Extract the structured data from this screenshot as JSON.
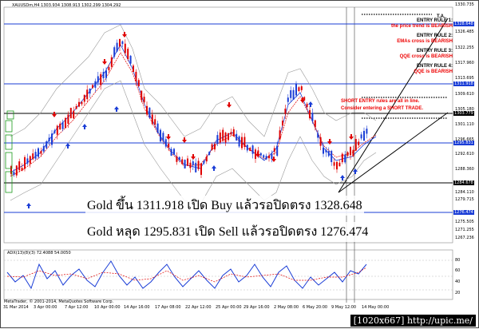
{
  "window": {
    "title": "XAUUSDm,H4  1303.934 1308.913 1302.299 1304.292"
  },
  "annotations": {
    "ta": "T.A.",
    "rules": [
      {
        "head": "ENTRY RULE 1:",
        "text": "the price trend is BEARISH"
      },
      {
        "head": "ENTRY RULE 2:",
        "text": "EMAs cross is BEARISH"
      },
      {
        "head": "ENTRY RULE 3:",
        "text": "QQE cross is BEARISH"
      },
      {
        "head": "ENTRY RULE 4:",
        "text": "QQE is BEARISH"
      }
    ],
    "short_line1": "SHORT ENTRY rules are all in line.",
    "short_line2": "Consider entering a SHORT TRADE.",
    "caption1": "Gold ขึ้น 1311.918 เปิด Buy แล้วรอปิดตรง 1328.648",
    "caption2": "Gold หลุด 1295.831 เปิด Sell แล้วรอปิดตรง 1276.474"
  },
  "price_axis": {
    "ticks": [
      "1330.735",
      "1326.485",
      "1322.255",
      "1317.960",
      "1313.695",
      "1309.610",
      "1305.180",
      "1301.110",
      "1296.665",
      "1292.610",
      "1288.360",
      "1284.110",
      "1279.715",
      "1275.505",
      "1271.255",
      "1267.236"
    ],
    "labels": [
      {
        "value": "1328.648",
        "color": "#1a3dd6"
      },
      {
        "value": "1311.918",
        "color": "#1a3dd6"
      },
      {
        "value": "1303.779",
        "color": "#000000"
      },
      {
        "value": "1295.831",
        "color": "#1a3dd6"
      },
      {
        "value": "1284.678",
        "color": "#000000"
      },
      {
        "value": "1276.474",
        "color": "#1a3dd6"
      }
    ]
  },
  "time_axis": {
    "ticks": [
      "31 Mar 2014",
      "3 Apr 00:00",
      "7 Apr 12:00",
      "10 Apr 00:00",
      "14 Apr 16:00",
      "17 Apr 08:00",
      "22 Apr 12:00",
      "25 Apr 00:00",
      "29 Apr 16:00",
      "2 May 08:00",
      "6 May 20:00",
      "9 May 12:00",
      "14 May 00:00"
    ]
  },
  "indicator": {
    "label": "ADX(13)(8)(3) 72.4088 54.0050",
    "ticks": [
      "80",
      "60",
      "40",
      "20"
    ]
  },
  "footer": {
    "copyright": "MetaTrader, © 2001-2014, MetaQuotes Software Corp."
  },
  "watermark": "[1020x667] http://upic.me/",
  "colors": {
    "bull": "#1a3dd6",
    "bear": "#e00000",
    "hline": "#1a3dd6",
    "ema": "#1a3dd6",
    "arrow_up": "#1a3dd6",
    "arrow_down": "#e00000"
  }
}
